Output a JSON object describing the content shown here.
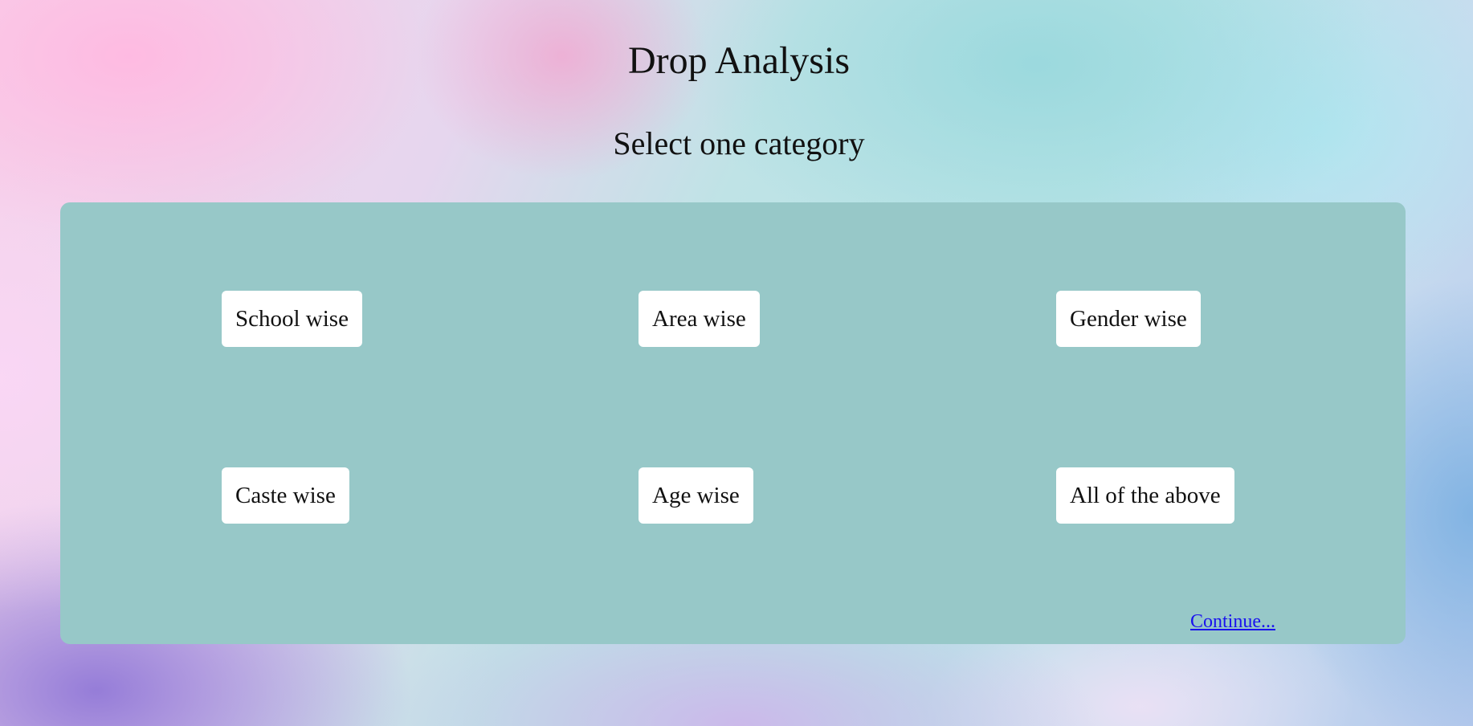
{
  "page": {
    "title": "Drop Analysis",
    "subtitle": "Select one category"
  },
  "categories": [
    {
      "label": "School wise"
    },
    {
      "label": "Area wise"
    },
    {
      "label": "Gender wise"
    },
    {
      "label": "Caste wise"
    },
    {
      "label": "Age wise"
    },
    {
      "label": "All of the above"
    }
  ],
  "continue_label": "Continue...",
  "colors": {
    "panel": "#97c8c8",
    "button": "#ffffff",
    "link": "#1a12ee"
  }
}
